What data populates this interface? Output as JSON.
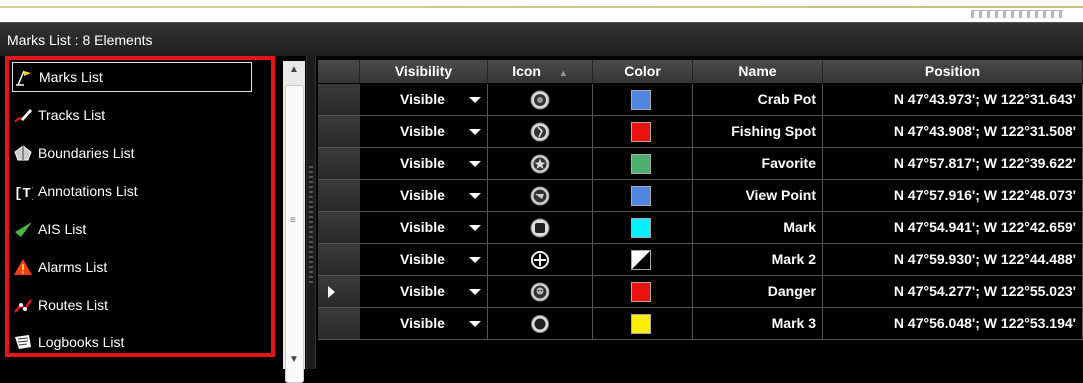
{
  "window": {
    "title": "Marks List : 8 Elements"
  },
  "nav": {
    "items": [
      {
        "label": "Marks List",
        "icon": "flag-icon",
        "selected": true
      },
      {
        "label": "Tracks List",
        "icon": "track-pen-icon",
        "selected": false
      },
      {
        "label": "Boundaries List",
        "icon": "boundary-icon",
        "selected": false
      },
      {
        "label": "Annotations List",
        "icon": "annotation-text-icon",
        "selected": false
      },
      {
        "label": "AIS List",
        "icon": "ais-triangle-icon",
        "selected": false
      },
      {
        "label": "Alarms List",
        "icon": "alarm-warning-icon",
        "selected": false
      },
      {
        "label": "Routes List",
        "icon": "route-icon",
        "selected": false
      },
      {
        "label": "Logbooks List",
        "icon": "logbook-icon",
        "selected": false
      }
    ]
  },
  "table": {
    "columns": [
      "Visibility",
      "Icon",
      "Color",
      "Name",
      "Position"
    ],
    "sort_indicator": "▲",
    "rows": [
      {
        "visibility": "Visible",
        "icon": "crab-pot-icon",
        "color": "#4f86e0",
        "name": "Crab Pot",
        "position": "N 47°43.973'; W 122°31.643'"
      },
      {
        "visibility": "Visible",
        "icon": "fishing-spot-icon",
        "color": "#ee1111",
        "name": "Fishing Spot",
        "position": "N 47°43.908'; W 122°31.508'"
      },
      {
        "visibility": "Visible",
        "icon": "star-icon",
        "color": "#4caf6e",
        "name": "Favorite",
        "position": "N 47°57.817'; W 122°39.622'"
      },
      {
        "visibility": "Visible",
        "icon": "view-point-icon",
        "color": "#4f86e0",
        "name": "View Point",
        "position": "N 47°57.916'; W 122°48.073'"
      },
      {
        "visibility": "Visible",
        "icon": "square-mark-icon",
        "color": "#00f0ff",
        "name": "Mark",
        "position": "N 47°54.941'; W 122°42.659'"
      },
      {
        "visibility": "Visible",
        "icon": "crosshair-icon",
        "color": "#000000/#ffffff",
        "name": "Mark 2",
        "position": "N 47°59.930'; W 122°44.488'"
      },
      {
        "visibility": "Visible",
        "icon": "skull-danger-icon",
        "color": "#ee1111",
        "name": "Danger",
        "position": "N 47°54.277'; W 122°55.023'"
      },
      {
        "visibility": "Visible",
        "icon": "circle-mark-icon",
        "color": "#ffee00",
        "name": "Mark 3",
        "position": "N 47°56.048'; W 122°53.194'"
      }
    ],
    "current_row_index": 6
  }
}
